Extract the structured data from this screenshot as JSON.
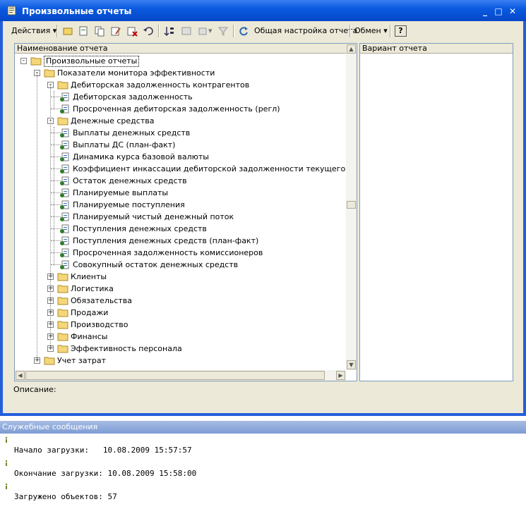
{
  "window": {
    "title": "Произвольные отчеты"
  },
  "toolbar": {
    "actions_label": "Действия",
    "settings_label": "Общая настройка отчета",
    "exchange_label": "Обмен",
    "help_label": "?"
  },
  "tree": {
    "header": "Наименование отчета",
    "root": "Произвольные отчеты",
    "monitor": "Показатели монитора эффективности",
    "debt_group": "Дебиторская задолженность контрагентов",
    "debt_items": [
      "Дебиторская задолженность",
      "Просроченная дебиторская задолженность (регл)"
    ],
    "cash_group": "Денежные средства",
    "cash_items": [
      "Выплаты денежных средств",
      "Выплаты ДС (план-факт)",
      "Динамика курса базовой валюты",
      "Коэффициент инкассации дебиторской задолженности текущего периода",
      "Остаток денежных средств",
      "Планируемые выплаты",
      "Планируемые поступления",
      "Планируемый чистый денежный поток",
      "Поступления денежных средств",
      "Поступления денежных средств (план-факт)",
      "Просроченная задолженность комиссионеров",
      "Совокупный остаток денежных средств"
    ],
    "other_groups": [
      "Клиенты",
      "Логистика",
      "Обязательства",
      "Продажи",
      "Производство",
      "Финансы",
      "Эффективность персонала"
    ],
    "cost_group": "Учет затрат"
  },
  "variant": {
    "header": "Вариант отчета"
  },
  "description": {
    "label": "Описание:"
  },
  "messages": {
    "title": "Служебные сообщения",
    "lines": [
      "Начало загрузки:   10.08.2009 15:57:57",
      "Окончание загрузки: 10.08.2009 15:58:00",
      "Загружено объектов: 57"
    ]
  },
  "colors": {
    "titlebar": "#0a5ae0",
    "face": "#ece9d8",
    "messages_bar": "#7d9bd4"
  }
}
